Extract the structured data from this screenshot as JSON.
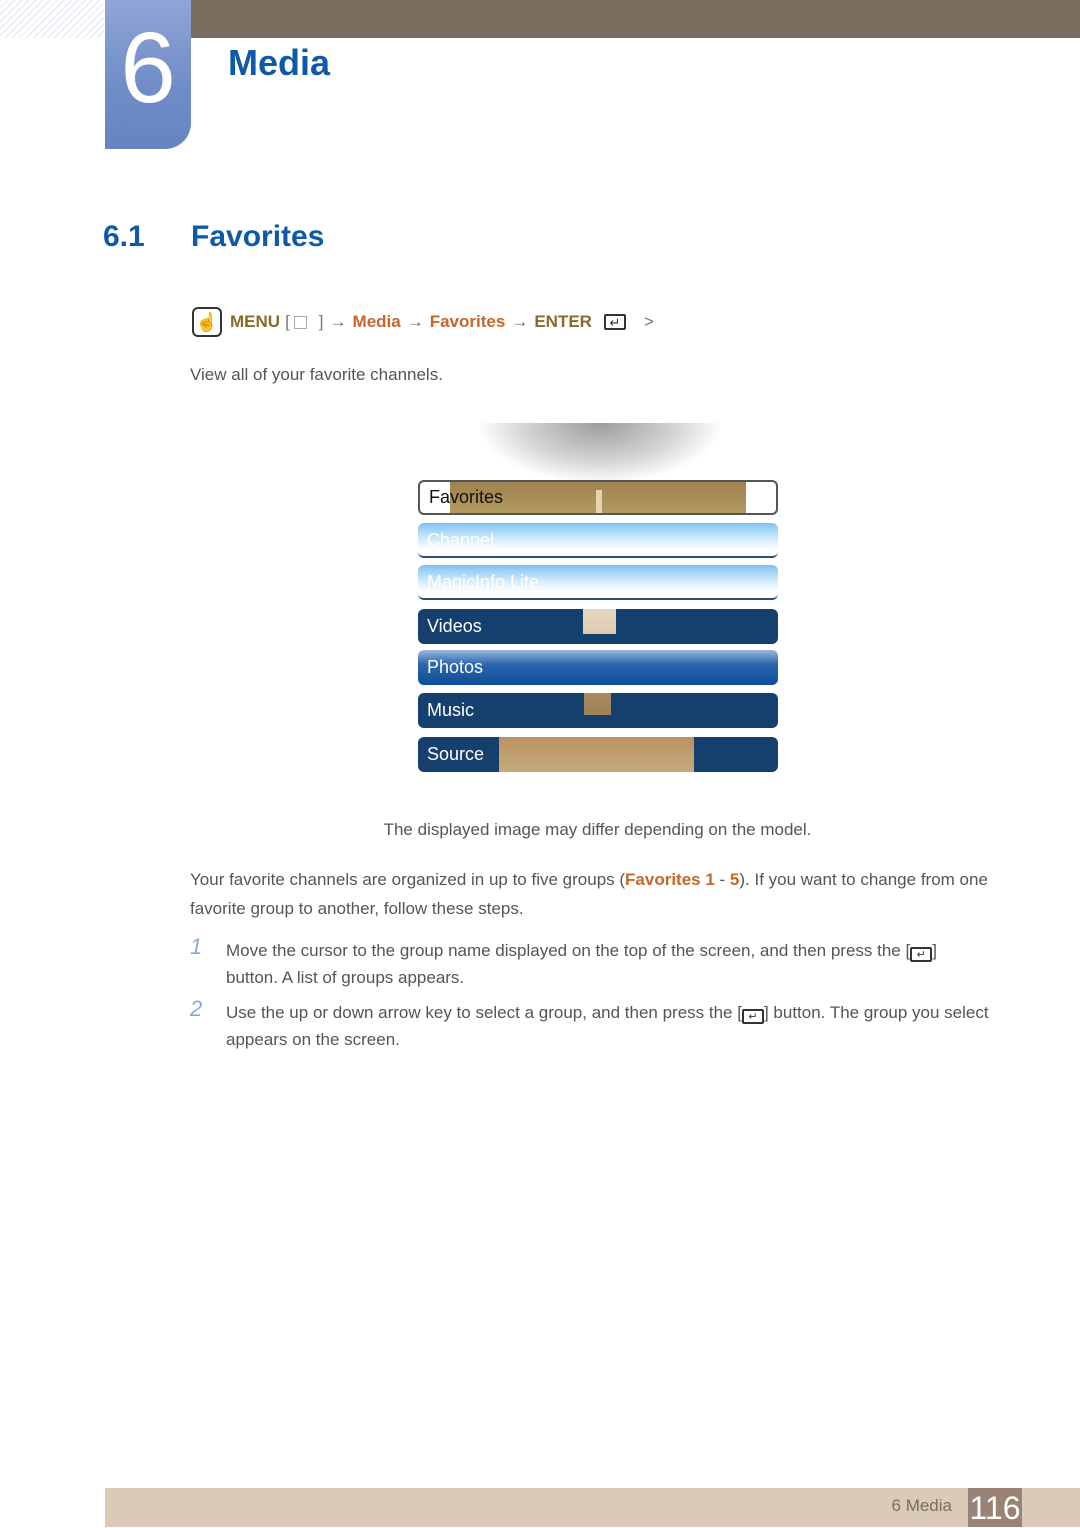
{
  "chapter": {
    "number": "6",
    "title": "Media"
  },
  "section": {
    "number": "6.1",
    "title": "Favorites"
  },
  "menu_path": {
    "icon": "hand-touch-icon",
    "menu_label": "MENU",
    "bracket_open": "[",
    "bracket_close": "]",
    "arrow": "→",
    "step1": "Media",
    "step2": "Favorites",
    "enter_label": "ENTER",
    "enter_glyph": "↵",
    "trailing": ">"
  },
  "intro": "View all of your favorite channels.",
  "screen_menu": {
    "items": [
      {
        "label": "Favorites",
        "state": "highlighted"
      },
      {
        "label": "Channel",
        "state": "faded"
      },
      {
        "label": "MagicInfo Lite",
        "state": "faded"
      },
      {
        "label": "Videos",
        "state": "normal"
      },
      {
        "label": "Photos",
        "state": "selected"
      },
      {
        "label": "Music",
        "state": "normal"
      },
      {
        "label": "Source",
        "state": "normal"
      }
    ]
  },
  "caption": "The displayed image may differ depending on the model.",
  "paragraph": {
    "before": "Your favorite channels are organized in up to five groups (",
    "hl1": "Favorites 1",
    "sep": " - ",
    "hl2": "5",
    "after": "). If you want to change from one favorite group to another, follow these steps."
  },
  "steps": [
    {
      "num": "1",
      "before": "Move the cursor to the group name displayed on the top of the screen, and then press the [",
      "glyph": "↵",
      "after": "] button. A list of groups appears."
    },
    {
      "num": "2",
      "before": "Use the up or down arrow key to select a group, and then press the [",
      "glyph": "↵",
      "after": "] button. The group you select appears on the screen."
    }
  ],
  "footer": {
    "label": "6 Media",
    "page": "116"
  }
}
